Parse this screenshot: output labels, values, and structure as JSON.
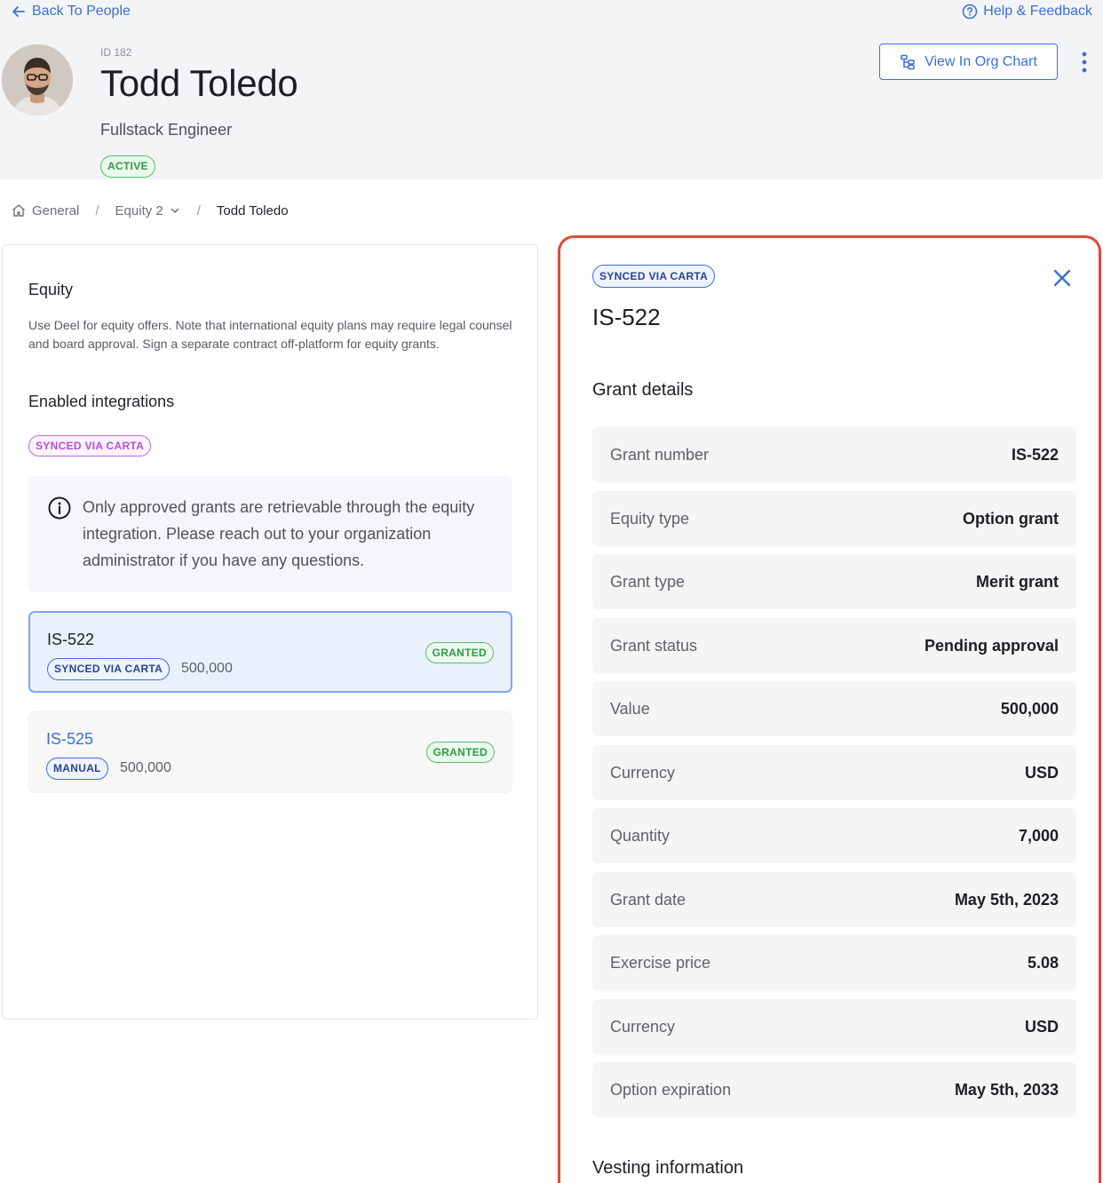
{
  "header": {
    "back_label": "Back To People",
    "help_label": "Help & Feedback",
    "employee_id": "ID 182",
    "employee_name": "Todd Toledo",
    "employee_role": "Fullstack Engineer",
    "status": "ACTIVE",
    "org_chart_label": "View In Org Chart"
  },
  "breadcrumb": {
    "items": [
      "General",
      "Equity 2",
      "Todd Toledo"
    ],
    "separator": "/"
  },
  "equity_panel": {
    "title": "Equity",
    "description": "Use Deel for equity offers. Note that international equity plans may require legal counsel and board approval. Sign a separate contract off-platform for equity grants.",
    "integrations_title": "Enabled integrations",
    "integration_tag": "SYNCED VIA CARTA",
    "info_text": "Only approved grants are retrievable through the equity integration. Please reach out to your organization administrator if you have any questions.",
    "grants": [
      {
        "id": "IS-522",
        "source": "SYNCED VIA CARTA",
        "amount": "500,000",
        "status": "GRANTED"
      },
      {
        "id": "IS-525",
        "source": "MANUAL",
        "amount": "500,000",
        "status": "GRANTED"
      }
    ]
  },
  "detail_panel": {
    "source_tag": "SYNCED VIA CARTA",
    "title": "IS-522",
    "section_title": "Grant details",
    "rows": [
      {
        "label": "Grant number",
        "value": "IS-522"
      },
      {
        "label": "Equity type",
        "value": "Option grant"
      },
      {
        "label": "Grant type",
        "value": "Merit grant"
      },
      {
        "label": "Grant status",
        "value": "Pending approval"
      },
      {
        "label": "Value",
        "value": "500,000"
      },
      {
        "label": "Currency",
        "value": "USD"
      },
      {
        "label": "Quantity",
        "value": "7,000"
      },
      {
        "label": "Grant date",
        "value": "May 5th, 2023"
      },
      {
        "label": "Exercise price",
        "value": "5.08"
      },
      {
        "label": "Currency",
        "value": "USD"
      },
      {
        "label": "Option expiration",
        "value": "May 5th, 2033"
      }
    ],
    "vesting_title": "Vesting information"
  },
  "colors": {
    "accent": "#3b6fd8",
    "success": "#2f9a46",
    "carta_purple": "#b44fd6",
    "highlight_border": "#dd4a35"
  },
  "icons": {
    "back": "arrow-left-icon",
    "help": "question-circle-icon",
    "org_chart": "org-chart-icon",
    "more": "kebab-menu-icon",
    "home": "home-icon",
    "dropdown": "chevron-down-icon",
    "info": "info-circle-icon",
    "close": "close-icon"
  }
}
